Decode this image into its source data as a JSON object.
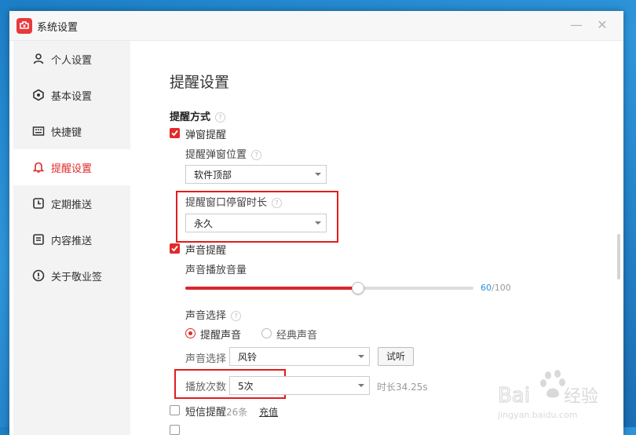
{
  "window": {
    "title": "系统设置"
  },
  "sidebar": {
    "items": [
      {
        "label": "个人设置",
        "icon": "user-icon"
      },
      {
        "label": "基本设置",
        "icon": "gear-icon"
      },
      {
        "label": "快捷键",
        "icon": "keyboard-icon"
      },
      {
        "label": "提醒设置",
        "icon": "bell-icon",
        "active": true
      },
      {
        "label": "定期推送",
        "icon": "clock-icon"
      },
      {
        "label": "内容推送",
        "icon": "document-icon"
      },
      {
        "label": "关于敬业签",
        "icon": "info-icon"
      }
    ]
  },
  "main": {
    "page_title": "提醒设置",
    "reminder_method": "提醒方式",
    "popup": {
      "label": "弹窗提醒",
      "checked": true,
      "position_label": "提醒弹窗位置",
      "position_value": "软件顶部",
      "duration_label": "提醒窗口停留时长",
      "duration_value": "永久"
    },
    "sound": {
      "label": "声音提醒",
      "checked": true,
      "volume_label": "声音播放音量",
      "volume_value": "60",
      "volume_max": "/100",
      "volume_fraction": 0.6,
      "choice_label": "声音选择",
      "option1": "提醒声音",
      "option2": "经典声音",
      "select_label": "声音选择",
      "select_value": "风铃",
      "preview_button": "试听",
      "play_count_label": "播放次数",
      "play_count_value": "5次",
      "duration_text": "时长34.25s"
    },
    "sms": {
      "label": "短信提醒",
      "count": "26条",
      "recharge": "充值"
    }
  },
  "colors": {
    "accent": "#e02b2b",
    "highlight": "#e41b1b"
  },
  "watermark": {
    "text": "Baidu经验",
    "url_text": "jingyan.baidu.com"
  }
}
